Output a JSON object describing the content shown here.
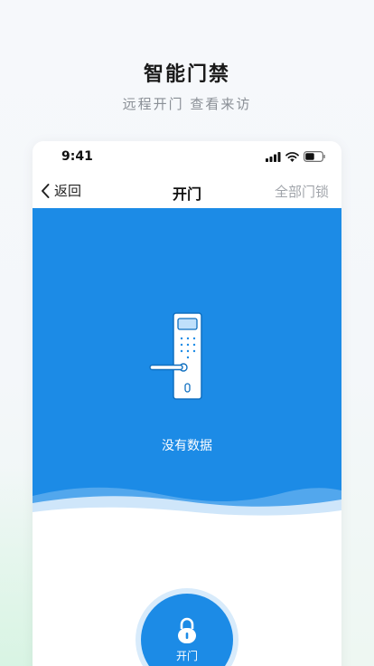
{
  "page": {
    "title": "智能门禁",
    "subtitle": "远程开门   查看来访"
  },
  "statusbar": {
    "time": "9:41"
  },
  "navbar": {
    "back_label": "返回",
    "title": "开门",
    "right_label": "全部门锁"
  },
  "banner": {
    "empty_text": "没有数据"
  },
  "action": {
    "open_label": "开门"
  },
  "colors": {
    "accent": "#1c8be6",
    "ring": "#d8ebfb"
  }
}
